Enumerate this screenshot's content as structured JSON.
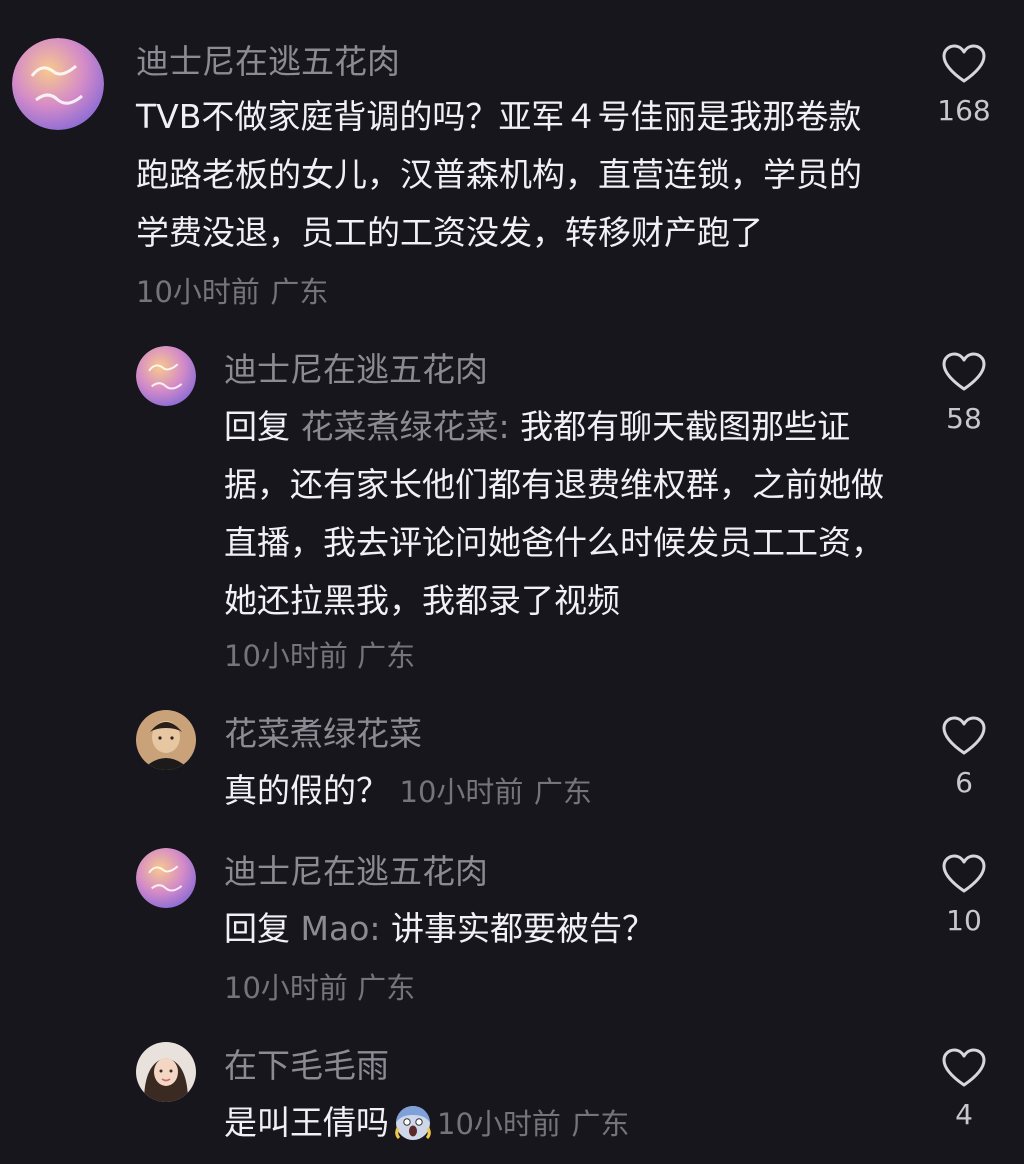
{
  "comments": [
    {
      "username": "迪士尼在逃五花肉",
      "body": "TVB不做家庭背调的吗？亚军４号佳丽是我那卷款跑路老板的女儿，汉普森机构，直营连锁，学员的学费没退，员工的工资没发，转移财产跑了",
      "time": "10小时前",
      "location": "广东",
      "likes": "168"
    },
    {
      "username": "迪士尼在逃五花肉",
      "reply_prefix": "回复",
      "reply_to": "花菜煮绿花菜:",
      "body": "我都有聊天截图那些证据，还有家长他们都有退费维权群，之前她做直播，我去评论问她爸什么时候发员工工资，她还拉黑我，我都录了视频",
      "time": "10小时前",
      "location": "广东",
      "likes": "58"
    },
    {
      "username": "花菜煮绿花菜",
      "body": "真的假的？",
      "time": "10小时前",
      "location": "广东",
      "likes": "6"
    },
    {
      "username": "迪士尼在逃五花肉",
      "reply_prefix": "回复",
      "reply_to": "Mao:",
      "body": "讲事实都要被告？",
      "time": "10小时前",
      "location": "广东",
      "likes": "10"
    },
    {
      "username": "在下毛毛雨",
      "body": "是叫王倩吗",
      "emoji": "scream-emoji",
      "time": "10小时前",
      "location": "广东",
      "likes": "4"
    }
  ],
  "colors": {
    "background": "#17161c",
    "username": "#8c8a92",
    "text": "#f1f0f4",
    "meta": "#75737b",
    "heart": "#d8d6dc"
  }
}
